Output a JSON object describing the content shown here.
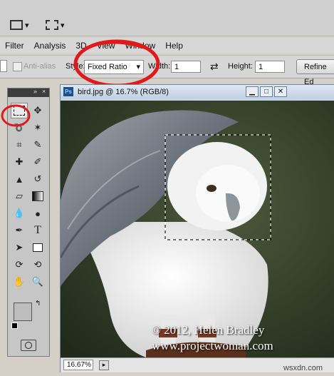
{
  "menu": {
    "items": [
      "Filter",
      "Analysis",
      "3D",
      "View",
      "Window",
      "Help"
    ]
  },
  "options": {
    "anti_alias_label": "Anti-alias",
    "style_label": "Style:",
    "style_value": "Fixed Ratio",
    "width_label": "Width:",
    "width_value": "1",
    "height_label": "Height:",
    "height_value": "1",
    "refine_edge_label": "Refine Ed"
  },
  "document": {
    "title": "bird.jpg @ 16.7% (RGB/8)",
    "ps_badge": "Ps",
    "zoom": "16.67%"
  },
  "watermark": {
    "line1": "© 2012, Helen Bradley",
    "line2": "www.projectwoman.com"
  },
  "site_mark": "wsxdn.com",
  "toolbox": {
    "header_glyph": "»",
    "close_glyph": "×"
  },
  "colors": {
    "annotation_red": "#e01a1a",
    "doc_titlebar": "#c0cfe2"
  },
  "icons": [
    "rect-marquee-icon",
    "move-icon",
    "lasso-icon",
    "magic-wand-icon",
    "crop-icon",
    "eyedropper-icon",
    "healing-icon",
    "brush-icon",
    "stamp-icon",
    "history-brush-icon",
    "eraser-icon",
    "gradient-icon",
    "blur-icon",
    "dodge-icon",
    "pen-icon",
    "type-icon",
    "path-select-icon",
    "shape-icon",
    "3d-rotate-icon",
    "3d-orbit-icon",
    "hand-icon",
    "zoom-icon"
  ]
}
